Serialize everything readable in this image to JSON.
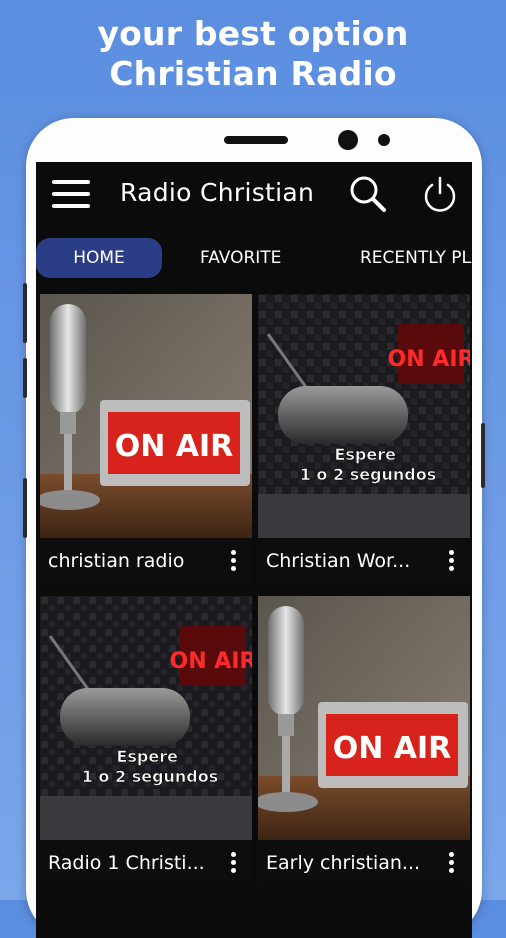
{
  "promo": {
    "line1": "your best option",
    "line2": "Christian Radio"
  },
  "appbar": {
    "title": "Radio Christian",
    "icons": [
      "menu-icon",
      "search-icon",
      "power-icon"
    ]
  },
  "tabs": [
    {
      "label": "HOME",
      "active": true
    },
    {
      "label": "FAVORITE",
      "active": false
    },
    {
      "label": "RECENTLY PLAYED",
      "active": false
    }
  ],
  "stations": [
    {
      "title": "christian radio",
      "image": "on-air-sign"
    },
    {
      "title": "Christian Wor...",
      "image": "studio-microphone",
      "overlay": "Espere\n1 o 2 segundos",
      "badge": "ON AIR"
    },
    {
      "title": "Radio 1 Christi...",
      "image": "studio-microphone",
      "overlay": "Espere\n1 o 2 segundos",
      "badge": "ON AIR"
    },
    {
      "title": "Early christian...",
      "image": "on-air-sign"
    }
  ],
  "colors": {
    "background": "#6a98e4",
    "active_tab": "#2a3d86",
    "screen": "#0b0b0b",
    "on_air_red": "#d8231c"
  }
}
